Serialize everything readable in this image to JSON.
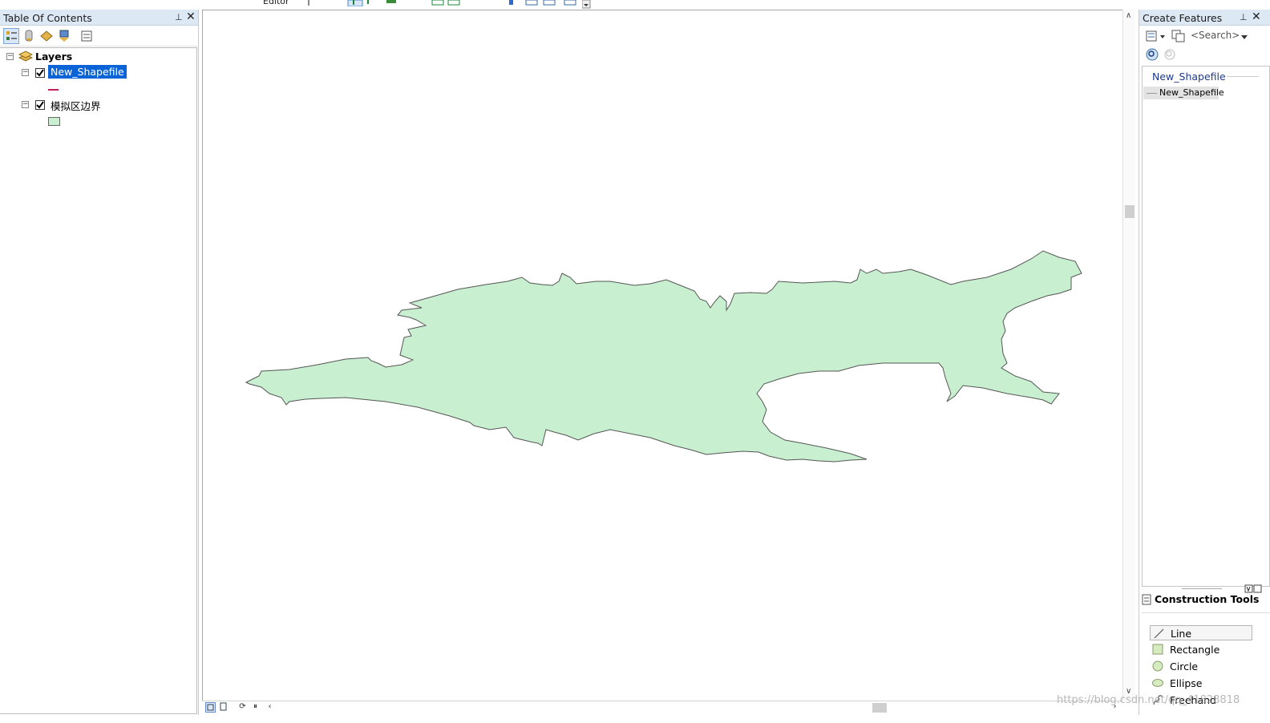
{
  "toolbar": {
    "editor_label": "Editor"
  },
  "toc": {
    "title": "Table Of Contents",
    "root_label": "Layers",
    "layers": [
      {
        "name": "New_Shapefile",
        "checked": true,
        "symbol": "line",
        "symbol_color": "#c02060"
      },
      {
        "name": "模拟区边界",
        "checked": true,
        "symbol": "polygon",
        "symbol_color": "#c8f0d0"
      }
    ]
  },
  "map": {
    "polygon_fill": "#c8f0d0",
    "polygon_stroke": "#555555"
  },
  "create_features": {
    "title": "Create Features",
    "search_placeholder": "<Search>",
    "group_label": "New_Shapefile",
    "template_label": "New_Shapefile"
  },
  "construction_tools": {
    "title": "Construction Tools",
    "items": [
      {
        "label": "Line",
        "icon": "line-icon"
      },
      {
        "label": "Rectangle",
        "icon": "rectangle-icon"
      },
      {
        "label": "Circle",
        "icon": "circle-icon"
      },
      {
        "label": "Ellipse",
        "icon": "ellipse-icon"
      },
      {
        "label": "Freehand",
        "icon": "freehand-icon"
      }
    ]
  },
  "watermark": "https://blog.csdn.net/qq_41828818"
}
